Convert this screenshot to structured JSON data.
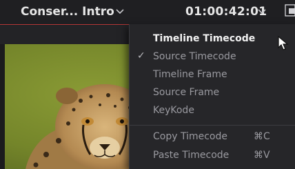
{
  "topbar": {
    "clip_name": "Conser... Intro",
    "clip_chevron_icon": "chevron-down-icon",
    "timecode": "01:00:42:01",
    "timecode_chevron_icon": "chevron-down-icon",
    "side_icon": "viewer-mode-icon"
  },
  "menu": {
    "items": [
      {
        "label": "Timeline Timecode",
        "checked": false,
        "highlighted": true
      },
      {
        "label": "Source Timecode",
        "checked": true,
        "highlighted": false
      },
      {
        "label": "Timeline Frame",
        "checked": false,
        "highlighted": false
      },
      {
        "label": "Source Frame",
        "checked": false,
        "highlighted": false
      },
      {
        "label": "KeyKode",
        "checked": false,
        "highlighted": false
      }
    ],
    "check_glyph": "✓",
    "actions": [
      {
        "label": "Copy Timecode",
        "shortcut": "⌘C"
      },
      {
        "label": "Paste Timecode",
        "shortcut": "⌘V"
      }
    ]
  },
  "colors": {
    "accent_red": "#b33636",
    "menu_bg": "#262629",
    "menu_text": "#9a9aa0",
    "menu_text_highlight": "#f2f2f2"
  }
}
